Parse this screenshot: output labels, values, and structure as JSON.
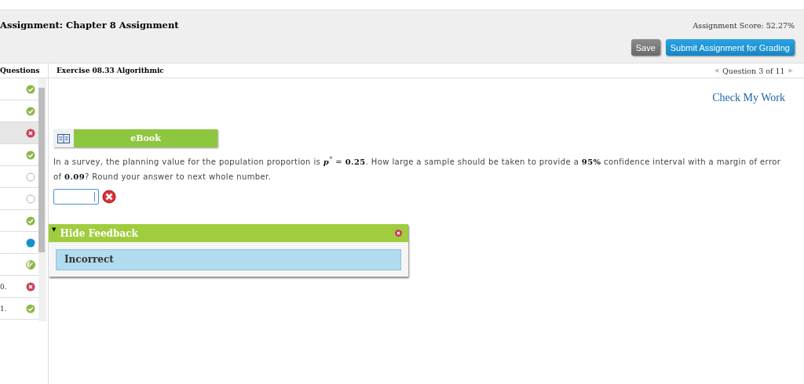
{
  "header": {
    "title": "Assignment: Chapter 8 Assignment",
    "score": "Assignment Score: 52.27%",
    "buttons": [
      {
        "label": "Save",
        "kind": "secondary"
      },
      {
        "label": "Submit Assignment for Grading",
        "kind": "primary"
      }
    ]
  },
  "sidebar": {
    "heading": "Questions",
    "items": [
      {
        "kind": "correct",
        "selected": false
      },
      {
        "kind": "correct",
        "selected": false
      },
      {
        "kind": "incorrect",
        "selected": true
      },
      {
        "kind": "correct",
        "selected": false
      },
      {
        "kind": "unanswered",
        "selected": false
      },
      {
        "kind": "unanswered",
        "selected": false
      },
      {
        "kind": "correct",
        "selected": false
      },
      {
        "kind": "current",
        "selected": false
      },
      {
        "kind": "partial",
        "selected": false
      },
      {
        "label": "0.",
        "kind": "incorrect",
        "selected": false
      },
      {
        "label": "1.",
        "kind": "correct",
        "selected": false
      }
    ]
  },
  "exercise": {
    "title": "Exercise 08.33 Algorithmic",
    "nav": {
      "prev": "◀",
      "label": "Question 3 of 11",
      "next": "▶"
    },
    "check_link": "Check My Work",
    "ebook": "eBook",
    "question": "In a survey, the planning value for the population proportion is *p*$^{*}$ = **0.25**. How large a sample should be taken to provide a **95%** confidence interval with a margin of error of **0.09**? Round your answer to next whole number.",
    "answer": {
      "kind": "incorrect"
    },
    "feedback": {
      "toggle": "▼",
      "title": "Hide Feedback",
      "message": "Incorrect"
    }
  }
}
